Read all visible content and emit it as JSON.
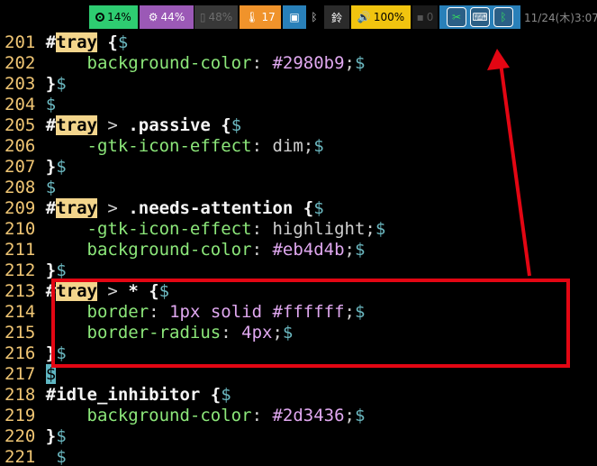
{
  "statusbar": {
    "cpu": "14%",
    "memory": "44%",
    "battery": "48%",
    "temperature": "17",
    "bluetooth_glyph": "ᛒ",
    "ime": "鈴",
    "volume": "100%",
    "idle": "0",
    "clock": "11/24(木)3:07",
    "colors": {
      "cpu": "#2ecc71",
      "memory": "#9b59b6",
      "temperature": "#f0932b",
      "network": "#2980b9",
      "volume": "#f1c40f",
      "tray": "#2980b9"
    }
  },
  "tray_icons": [
    "scissors-icon",
    "keyboard-icon",
    "bluetooth-icon"
  ],
  "editor": {
    "lines": [
      {
        "n": "201",
        "parts": [
          [
            "hash",
            "#"
          ],
          [
            "hl",
            "tray"
          ],
          [
            "sel",
            " {"
          ],
          [
            "eol",
            "$"
          ]
        ]
      },
      {
        "n": "202",
        "parts": [
          [
            "txt",
            "    "
          ],
          [
            "prop",
            "background-color"
          ],
          [
            "txt",
            ": "
          ],
          [
            "val",
            "#2980b9"
          ],
          [
            "txt",
            ";"
          ],
          [
            "eol",
            "$"
          ]
        ]
      },
      {
        "n": "203",
        "parts": [
          [
            "brace",
            "}"
          ],
          [
            "eol",
            "$"
          ]
        ]
      },
      {
        "n": "204",
        "parts": [
          [
            "eol",
            "$"
          ]
        ]
      },
      {
        "n": "205",
        "parts": [
          [
            "hash",
            "#"
          ],
          [
            "hl",
            "tray"
          ],
          [
            "txt",
            " > "
          ],
          [
            "sel",
            ".passive {"
          ],
          [
            "eol",
            "$"
          ]
        ]
      },
      {
        "n": "206",
        "parts": [
          [
            "txt",
            "    "
          ],
          [
            "prop",
            "-gtk-icon-effect"
          ],
          [
            "txt",
            ": "
          ],
          [
            "txt",
            "dim;"
          ],
          [
            "eol",
            "$"
          ]
        ]
      },
      {
        "n": "207",
        "parts": [
          [
            "brace",
            "}"
          ],
          [
            "eol",
            "$"
          ]
        ]
      },
      {
        "n": "208",
        "parts": [
          [
            "eol",
            "$"
          ]
        ]
      },
      {
        "n": "209",
        "parts": [
          [
            "hash",
            "#"
          ],
          [
            "hl",
            "tray"
          ],
          [
            "txt",
            " > "
          ],
          [
            "sel",
            ".needs-attention {"
          ],
          [
            "eol",
            "$"
          ]
        ]
      },
      {
        "n": "210",
        "parts": [
          [
            "txt",
            "    "
          ],
          [
            "prop",
            "-gtk-icon-effect"
          ],
          [
            "txt",
            ": "
          ],
          [
            "txt",
            "highlight;"
          ],
          [
            "eol",
            "$"
          ]
        ]
      },
      {
        "n": "211",
        "parts": [
          [
            "txt",
            "    "
          ],
          [
            "prop",
            "background-color"
          ],
          [
            "txt",
            ": "
          ],
          [
            "val",
            "#eb4d4b"
          ],
          [
            "txt",
            ";"
          ],
          [
            "eol",
            "$"
          ]
        ]
      },
      {
        "n": "212",
        "parts": [
          [
            "brace",
            "}"
          ],
          [
            "eol",
            "$"
          ]
        ]
      },
      {
        "n": "213",
        "parts": [
          [
            "hash",
            "#"
          ],
          [
            "hl",
            "tray"
          ],
          [
            "txt",
            " > "
          ],
          [
            "sel",
            "* {"
          ],
          [
            "eol",
            "$"
          ]
        ]
      },
      {
        "n": "214",
        "parts": [
          [
            "txt",
            "    "
          ],
          [
            "prop",
            "border"
          ],
          [
            "txt",
            ": "
          ],
          [
            "val",
            "1px solid #ffffff"
          ],
          [
            "txt",
            ";"
          ],
          [
            "eol",
            "$"
          ]
        ]
      },
      {
        "n": "215",
        "parts": [
          [
            "txt",
            "    "
          ],
          [
            "prop",
            "border-radius"
          ],
          [
            "txt",
            ": "
          ],
          [
            "val",
            "4px"
          ],
          [
            "txt",
            ";"
          ],
          [
            "eol",
            "$"
          ]
        ]
      },
      {
        "n": "216",
        "parts": [
          [
            "brace",
            "}"
          ],
          [
            "eol",
            "$"
          ]
        ]
      },
      {
        "n": "217",
        "parts": [
          [
            "cursor",
            "$"
          ]
        ]
      },
      {
        "n": "218",
        "parts": [
          [
            "hash",
            "#"
          ],
          [
            "sel",
            "idle_inhibitor {"
          ],
          [
            "eol",
            "$"
          ]
        ]
      },
      {
        "n": "219",
        "parts": [
          [
            "txt",
            "    "
          ],
          [
            "prop",
            "background-color"
          ],
          [
            "txt",
            ": "
          ],
          [
            "val",
            "#2d3436"
          ],
          [
            "txt",
            ";"
          ],
          [
            "eol",
            "$"
          ]
        ]
      },
      {
        "n": "220",
        "parts": [
          [
            "brace",
            "}"
          ],
          [
            "eol",
            "$"
          ]
        ]
      },
      {
        "n": "221",
        "parts": [
          [
            "txt",
            " "
          ],
          [
            "eol",
            "$"
          ]
        ]
      }
    ]
  },
  "annotation": {
    "color": "#e30613"
  }
}
